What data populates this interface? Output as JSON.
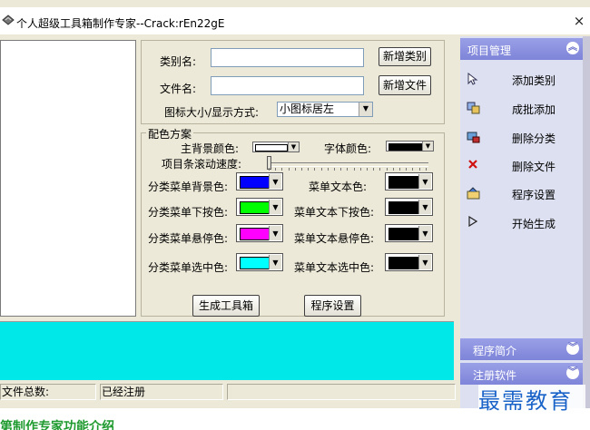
{
  "window": {
    "title": "个人超级工具箱制作专家--Crack:rEn22gE",
    "close_glyph": "×"
  },
  "form": {
    "category_label": "类别名:",
    "category_value": "",
    "file_label": "文件名:",
    "file_value": "",
    "icon_mode_label": "图标大小/显示方式:",
    "icon_mode_value": "小图标居左",
    "add_category_button": "新增类别",
    "add_file_button": "新增文件"
  },
  "scheme": {
    "title": "配色方案",
    "main_bg_label": "主背景颜色:",
    "main_bg_color": "#ffffff",
    "font_color_label": "字体颜色:",
    "font_color": "#000000",
    "scroll_speed_label": "项目条滚动速度:",
    "scroll_speed": 0,
    "rows": [
      {
        "left_label": "分类菜单背景色:",
        "left_color": "#0000ff",
        "right_label": "菜单文本色:",
        "right_color": "#000000"
      },
      {
        "left_label": "分类菜单下按色:",
        "left_color": "#00ff00",
        "right_label": "菜单文本下按色:",
        "right_color": "#000000"
      },
      {
        "left_label": "分类菜单悬停色:",
        "left_color": "#ff00ff",
        "right_label": "菜单文本悬停色:",
        "right_color": "#000000"
      },
      {
        "left_label": "分类菜单选中色:",
        "left_color": "#00ffff",
        "right_label": "菜单文本选中色:",
        "right_color": "#000000"
      }
    ]
  },
  "actions": {
    "generate_button": "生成工具箱",
    "settings_button": "程序设置"
  },
  "preview": {
    "color": "#00e8e8"
  },
  "status": {
    "file_count_label": "文件总数:",
    "registered": "已经注册",
    "third": ""
  },
  "sidebar": {
    "header_main": "项目管理",
    "items": [
      {
        "label": "添加类别",
        "icon": "cursor-icon"
      },
      {
        "label": "成批添加",
        "icon": "batch-icon"
      },
      {
        "label": "删除分类",
        "icon": "delete-category-icon"
      },
      {
        "label": "删除文件",
        "icon": "red-x-icon"
      },
      {
        "label": "程序设置",
        "icon": "settings-icon"
      },
      {
        "label": "开始生成",
        "icon": "play-icon"
      }
    ],
    "header_intro": "程序简介",
    "header_register": "注册软件",
    "chevron_glyph": "»"
  },
  "watermark": {
    "text": "最需教育"
  },
  "bottom_heading": {
    "text": "第制作专家功能介绍"
  },
  "colors": {
    "window_bg": "#ece9d8",
    "sidebar_header": "#8a90e0",
    "sidebar_bg": "#dde0f0",
    "watermark": "#1a63c8",
    "heading_green": "#1e9a2e"
  }
}
